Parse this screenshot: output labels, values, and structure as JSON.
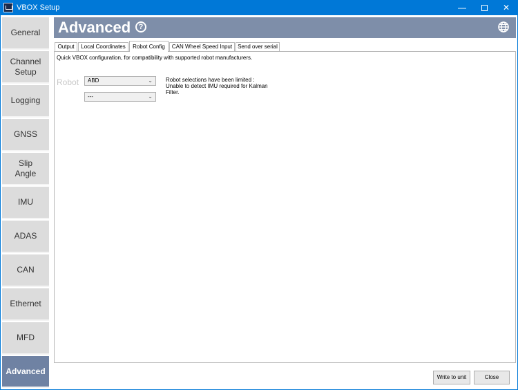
{
  "window": {
    "title": "VBOX Setup",
    "minimize_glyph": "—",
    "close_glyph": "✕"
  },
  "sidebar": {
    "items": [
      {
        "label": "General"
      },
      {
        "label": "Channel\nSetup"
      },
      {
        "label": "Logging"
      },
      {
        "label": "GNSS"
      },
      {
        "label": "Slip\nAngle"
      },
      {
        "label": "IMU"
      },
      {
        "label": "ADAS"
      },
      {
        "label": "CAN"
      },
      {
        "label": "Ethernet"
      },
      {
        "label": "MFD"
      },
      {
        "label": "Advanced",
        "active": true
      }
    ]
  },
  "header": {
    "title": "Advanced",
    "help_glyph": "?"
  },
  "tabs": [
    {
      "label": "Output"
    },
    {
      "label": "Local Coordinates"
    },
    {
      "label": "Robot Config",
      "active": true
    },
    {
      "label": "CAN Wheel Speed Input"
    },
    {
      "label": "Send over serial"
    }
  ],
  "robot_config": {
    "description": "Quick VBOX configuration, for compatibility with supported robot manufacturers.",
    "robot_label": "Robot",
    "robot_select_value": "ABD",
    "second_select_value": "---",
    "notice": "Robot selections have been limited :\nUnable to detect IMU required for Kalman\nFilter.",
    "chevron_glyph": "⌄"
  },
  "footer": {
    "write_label": "Write to unit",
    "close_label": "Close"
  },
  "colors": {
    "titlebar": "#0078d7",
    "header": "#7e8ea9",
    "sidebar_active": "#6f82a3",
    "sidebar_item": "#dcdcdc"
  }
}
